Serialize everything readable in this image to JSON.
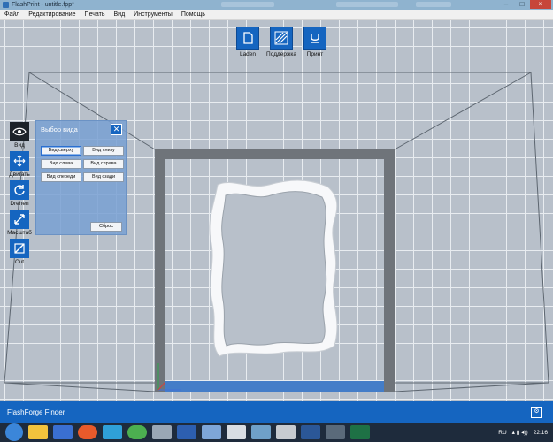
{
  "window": {
    "title": "FlashPrint - untitle.fpp*"
  },
  "menu": [
    "Файл",
    "Редактирование",
    "Печать",
    "Вид",
    "Инструменты",
    "Помощь"
  ],
  "top_toolbar": [
    {
      "label": "Laden",
      "icon": "load-icon"
    },
    {
      "label": "Поддержка",
      "icon": "support-icon"
    },
    {
      "label": "Принт",
      "icon": "print-icon"
    }
  ],
  "left_toolbar": [
    {
      "label": "Вид",
      "icon": "eye-icon",
      "active": true
    },
    {
      "label": "Двигать",
      "icon": "move-icon"
    },
    {
      "label": "Drehen",
      "icon": "rotate-icon"
    },
    {
      "label": "Масштаб",
      "icon": "scale-icon"
    },
    {
      "label": "Cut",
      "icon": "cut-icon"
    }
  ],
  "view_panel": {
    "title": "Выбор вида",
    "buttons": [
      "Вид сверху",
      "Вид снизу",
      "Вид слева",
      "Вид справа",
      "Вид спереди",
      "Вид сзади"
    ],
    "selected": "Вид сверху",
    "reset_label": "Сброс"
  },
  "bottom_bar": {
    "label": "FlashForge Finder"
  },
  "taskbar": {
    "lang": "RU",
    "time": "22:16"
  },
  "colors": {
    "accent": "#1565c0",
    "grid_bg": "#b8c0ca",
    "plate_border": "#6f747a",
    "plate_highlight": "#3d7fd6"
  }
}
